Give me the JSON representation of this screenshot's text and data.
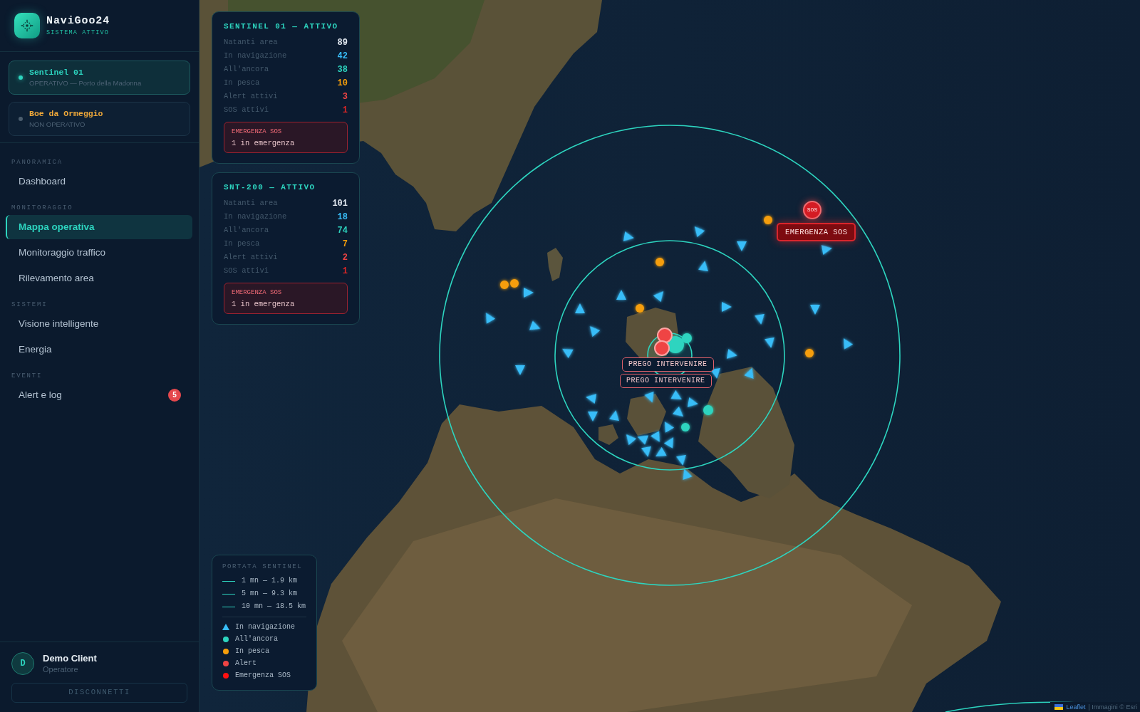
{
  "brand": {
    "name": "NaviGoo24",
    "status": "SISTEMA ATTIVO"
  },
  "devices": [
    {
      "name": "Sentinel 01",
      "status": "OPERATIVO — Porto della Madonna",
      "selected": true,
      "operational": true
    },
    {
      "name": "Boe da Ormeggio",
      "status": "NON OPERATIVO",
      "selected": false,
      "operational": false
    }
  ],
  "nav": [
    {
      "section": "PANORAMICA",
      "items": [
        {
          "label": "Dashboard",
          "selected": false
        }
      ]
    },
    {
      "section": "MONITORAGGIO",
      "items": [
        {
          "label": "Mappa operativa",
          "selected": true
        },
        {
          "label": "Monitoraggio traffico",
          "selected": false
        },
        {
          "label": "Rilevamento area",
          "selected": false
        }
      ]
    },
    {
      "section": "SISTEMI",
      "items": [
        {
          "label": "Visione intelligente",
          "selected": false
        },
        {
          "label": "Energia",
          "selected": false
        }
      ]
    },
    {
      "section": "EVENTI",
      "items": [
        {
          "label": "Alert e log",
          "selected": false,
          "badge": "5"
        }
      ]
    }
  ],
  "user": {
    "initial": "D",
    "name": "Demo Client",
    "role": "Operatore"
  },
  "logout_button": "DISCONNETTI",
  "sentinels": [
    {
      "title": "SENTINEL 01 — ATTIVO",
      "stats": [
        {
          "label": "Natanti area",
          "value": "89",
          "color": "#e2e8f0"
        },
        {
          "label": "In navigazione",
          "value": "42",
          "color": "#38bdf8"
        },
        {
          "label": "All'ancora",
          "value": "38",
          "color": "#2dd4bf"
        },
        {
          "label": "In pesca",
          "value": "10",
          "color": "#f59e0b"
        },
        {
          "label": "Alert attivi",
          "value": "3",
          "color": "#ef4444"
        },
        {
          "label": "SOS attivi",
          "value": "1",
          "color": "#dc2626"
        }
      ],
      "alert": {
        "title": "EMERGENZA SOS",
        "text": "1 in emergenza"
      }
    },
    {
      "title": "SNT-200 — ATTIVO",
      "stats": [
        {
          "label": "Natanti area",
          "value": "101",
          "color": "#e2e8f0"
        },
        {
          "label": "In navigazione",
          "value": "18",
          "color": "#38bdf8"
        },
        {
          "label": "All'ancora",
          "value": "74",
          "color": "#2dd4bf"
        },
        {
          "label": "In pesca",
          "value": "7",
          "color": "#f59e0b"
        },
        {
          "label": "Alert attivi",
          "value": "2",
          "color": "#ef4444"
        },
        {
          "label": "SOS attivi",
          "value": "1",
          "color": "#dc2626"
        }
      ],
      "alert": {
        "title": "EMERGENZA SOS",
        "text": "1 in emergenza"
      }
    }
  ],
  "legend": {
    "title": "PORTATA SENTINEL",
    "ranges": [
      "1 mn — 1.9 km",
      "5 mn — 9.3 km",
      "10 mn — 18.5 km"
    ],
    "items": [
      {
        "kind": "navigation",
        "label": "In navigazione",
        "color": "#38bdf8"
      },
      {
        "kind": "anchored",
        "label": "All'ancora",
        "color": "#2dd4bf"
      },
      {
        "kind": "fishing",
        "label": "In pesca",
        "color": "#f59e0b"
      },
      {
        "kind": "alert",
        "label": "Alert",
        "color": "#ef4444"
      },
      {
        "kind": "sos",
        "label": "Emergenza SOS",
        "color": "#ff1010"
      }
    ]
  },
  "map": {
    "vessels": [
      {
        "kind": "navigation"
      },
      {
        "kind": "navigation"
      },
      {
        "kind": "navigation"
      },
      {
        "kind": "navigation"
      },
      {
        "kind": "navigation"
      },
      {
        "kind": "navigation"
      },
      {
        "kind": "navigation"
      },
      {
        "kind": "navigation"
      },
      {
        "kind": "navigation"
      },
      {
        "kind": "navigation"
      },
      {
        "kind": "navigation"
      },
      {
        "kind": "navigation"
      },
      {
        "kind": "navigation"
      },
      {
        "kind": "navigation"
      },
      {
        "kind": "navigation"
      },
      {
        "kind": "navigation"
      },
      {
        "kind": "navigation"
      },
      {
        "kind": "navigation"
      },
      {
        "kind": "navigation"
      },
      {
        "kind": "navigation"
      },
      {
        "kind": "navigation"
      },
      {
        "kind": "navigation"
      },
      {
        "kind": "navigation"
      },
      {
        "kind": "navigation"
      },
      {
        "kind": "navigation"
      },
      {
        "kind": "navigation"
      },
      {
        "kind": "navigation"
      },
      {
        "kind": "navigation"
      },
      {
        "kind": "navigation"
      },
      {
        "kind": "navigation"
      },
      {
        "kind": "navigation"
      },
      {
        "kind": "navigation"
      },
      {
        "kind": "navigation"
      },
      {
        "kind": "navigation"
      },
      {
        "kind": "navigation"
      },
      {
        "kind": "navigation"
      },
      {
        "kind": "navigation"
      },
      {
        "kind": "navigation"
      },
      {
        "kind": "fishing"
      },
      {
        "kind": "fishing"
      },
      {
        "kind": "fishing"
      },
      {
        "kind": "fishing"
      },
      {
        "kind": "fishing"
      },
      {
        "kind": "fishing"
      },
      {
        "kind": "anchored"
      },
      {
        "kind": "anchored"
      },
      {
        "kind": "anchored"
      },
      {
        "kind": "anchored"
      },
      {
        "kind": "alert"
      },
      {
        "kind": "alert"
      }
    ],
    "alert_labels": [
      "PREGO INTERVENIRE",
      "PREGO INTERVENIRE"
    ],
    "sos_marker": {
      "badge": "SOS",
      "label": "EMERGENZA SOS"
    }
  },
  "attribution": {
    "link": "Leaflet",
    "text": "| Immagini © Esri"
  }
}
